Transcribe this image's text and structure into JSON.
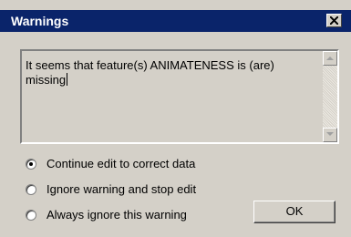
{
  "dialog": {
    "title": "Warnings",
    "message": "It seems that feature(s) ANIMATENESS is (are) missing",
    "options": [
      {
        "label": "Continue edit to correct data",
        "selected": true
      },
      {
        "label": "Ignore warning and stop edit",
        "selected": false
      },
      {
        "label": "Always ignore this warning",
        "selected": false
      }
    ],
    "ok_label": "OK"
  },
  "colors": {
    "titlebar": "#0a246a",
    "face": "#d4d0c8"
  }
}
